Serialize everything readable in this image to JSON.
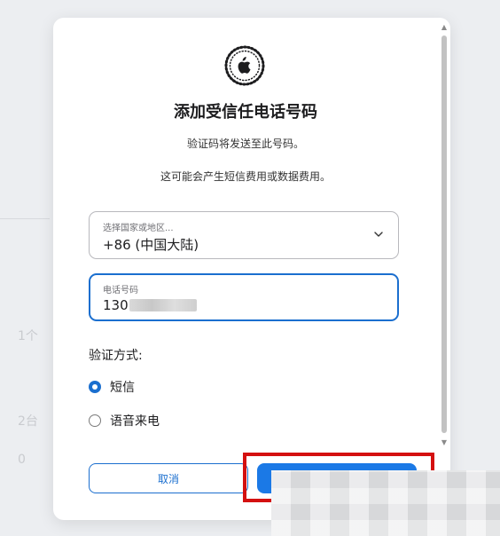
{
  "background": {
    "fragment_1": "1个",
    "fragment_2": "2台",
    "fragment_3": "0"
  },
  "dialog": {
    "title": "添加受信任电话号码",
    "description_1": "验证码将发送至此号码。",
    "description_2": "这可能会产生短信费用或数据费用。",
    "logo_icon": "apple-logo-icon",
    "country_field": {
      "label": "选择国家或地区...",
      "value": "+86 (中国大陆)"
    },
    "phone_field": {
      "label": "电话号码",
      "value": "130"
    },
    "verification": {
      "label": "验证方式:",
      "options": [
        {
          "label": "短信",
          "selected": true
        },
        {
          "label": "语音来电",
          "selected": false
        }
      ]
    },
    "buttons": {
      "cancel": "取消",
      "continue": ""
    }
  },
  "colors": {
    "accent": "#1b6fcf",
    "highlight": "#d41010"
  }
}
